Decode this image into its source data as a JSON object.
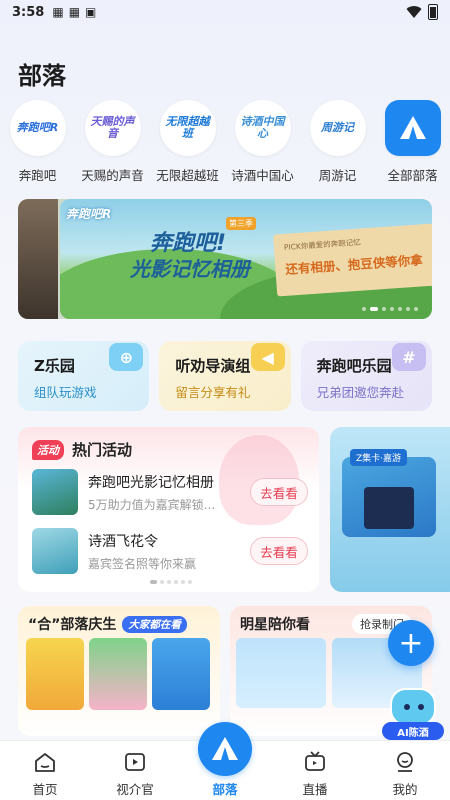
{
  "status": {
    "time": "3:58"
  },
  "page": {
    "title": "部落"
  },
  "tribes": [
    {
      "label": "奔跑吧",
      "logo_text": "奔跑吧R",
      "color": "#2a6fdb"
    },
    {
      "label": "天赐的声音",
      "logo_text": "天赐的声音",
      "color": "#6a5bd6"
    },
    {
      "label": "无限超越班",
      "logo_text": "无限超越班",
      "color": "#1e7bd8"
    },
    {
      "label": "诗酒中国心",
      "logo_text": "诗酒中国心",
      "color": "#3a8fd6"
    },
    {
      "label": "周游记",
      "logo_text": "周游记",
      "color": "#2f7fd2"
    },
    {
      "label": "全部部落",
      "logo_text": "",
      "color": "#1e87f0"
    }
  ],
  "banner": {
    "title_line1": "奔跑吧!",
    "title_line2": "光影记忆相册",
    "badge": "第三季",
    "paper_caption": "PICK你最爱的奔跑记忆",
    "paper_text": "还有相册、抱豆侠等你拿",
    "brand": "奔跑吧R"
  },
  "quick_cards": [
    {
      "title": "Z乐园",
      "subtitle": "组队玩游戏"
    },
    {
      "title": "听劝导演组",
      "subtitle": "留言分享有礼"
    },
    {
      "title": "奔跑吧乐园",
      "subtitle": "兄弟团邀您奔赴"
    }
  ],
  "hot": {
    "tag": "活动",
    "title": "热门活动",
    "items": [
      {
        "title": "奔跑吧光影记忆相册",
        "subtitle": "5万助力值为嘉宾解锁...",
        "button": "去看看"
      },
      {
        "title": "诗酒飞花令",
        "subtitle": "嘉宾签名照等你来赢",
        "button": "去看看"
      }
    ]
  },
  "promo": {
    "label": "Z集卡·嘉游"
  },
  "celebrate": {
    "title": "“合”部落庆生",
    "pill": "大家都在看"
  },
  "stars": {
    "title": "明星陪你看",
    "record": "抢录制门"
  },
  "ai": {
    "label": "AI陈酒"
  },
  "tabs": [
    {
      "label": "首页"
    },
    {
      "label": "视介官"
    },
    {
      "label": "部落"
    },
    {
      "label": "直播"
    },
    {
      "label": "我的"
    }
  ]
}
